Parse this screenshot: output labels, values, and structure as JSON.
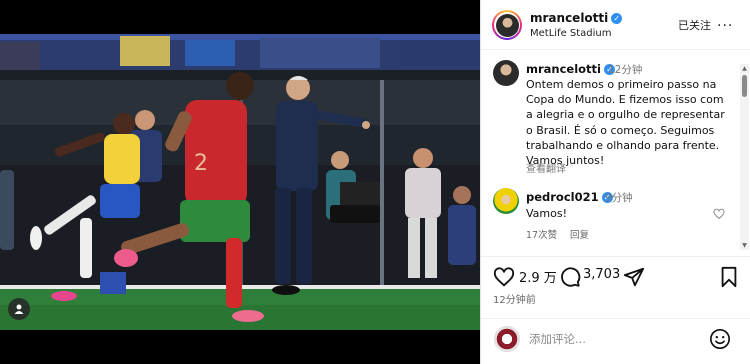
{
  "post": {
    "username": "mrancelotti",
    "location": "MetLife Stadium",
    "follow_status": "已关注",
    "more": "...",
    "caption": {
      "time": "12分钟",
      "text": "Ontem demos o primeiro passo na Copa do Mundo. E fizemos isso com a alegria e o orgulho de representar o Brasil. É só o começo. Seguimos trabalhando e olhando para frente. Vamos juntos!",
      "translate": "查看翻译"
    },
    "comments": [
      {
        "username": "pedrocl021",
        "time": "9分钟",
        "text": "Vamos!",
        "likes": "17次赞",
        "reply": "回复"
      }
    ],
    "actions": {
      "like_count": "2.9 万",
      "comment_count": "3,703",
      "posted": "12分钟前"
    },
    "add_comment": {
      "placeholder": "添加评论..."
    }
  },
  "colors": {
    "verified": "#2f8ff0",
    "brazil_yellow": "#f2d13a",
    "portugal_red": "#d22a2a",
    "pitch_green": "#2f7f3a"
  },
  "icons": [
    "verified-badge-icon",
    "heart-icon",
    "comment-icon",
    "share-icon",
    "bookmark-icon",
    "emoji-icon",
    "user-tag-icon",
    "more-icon"
  ]
}
